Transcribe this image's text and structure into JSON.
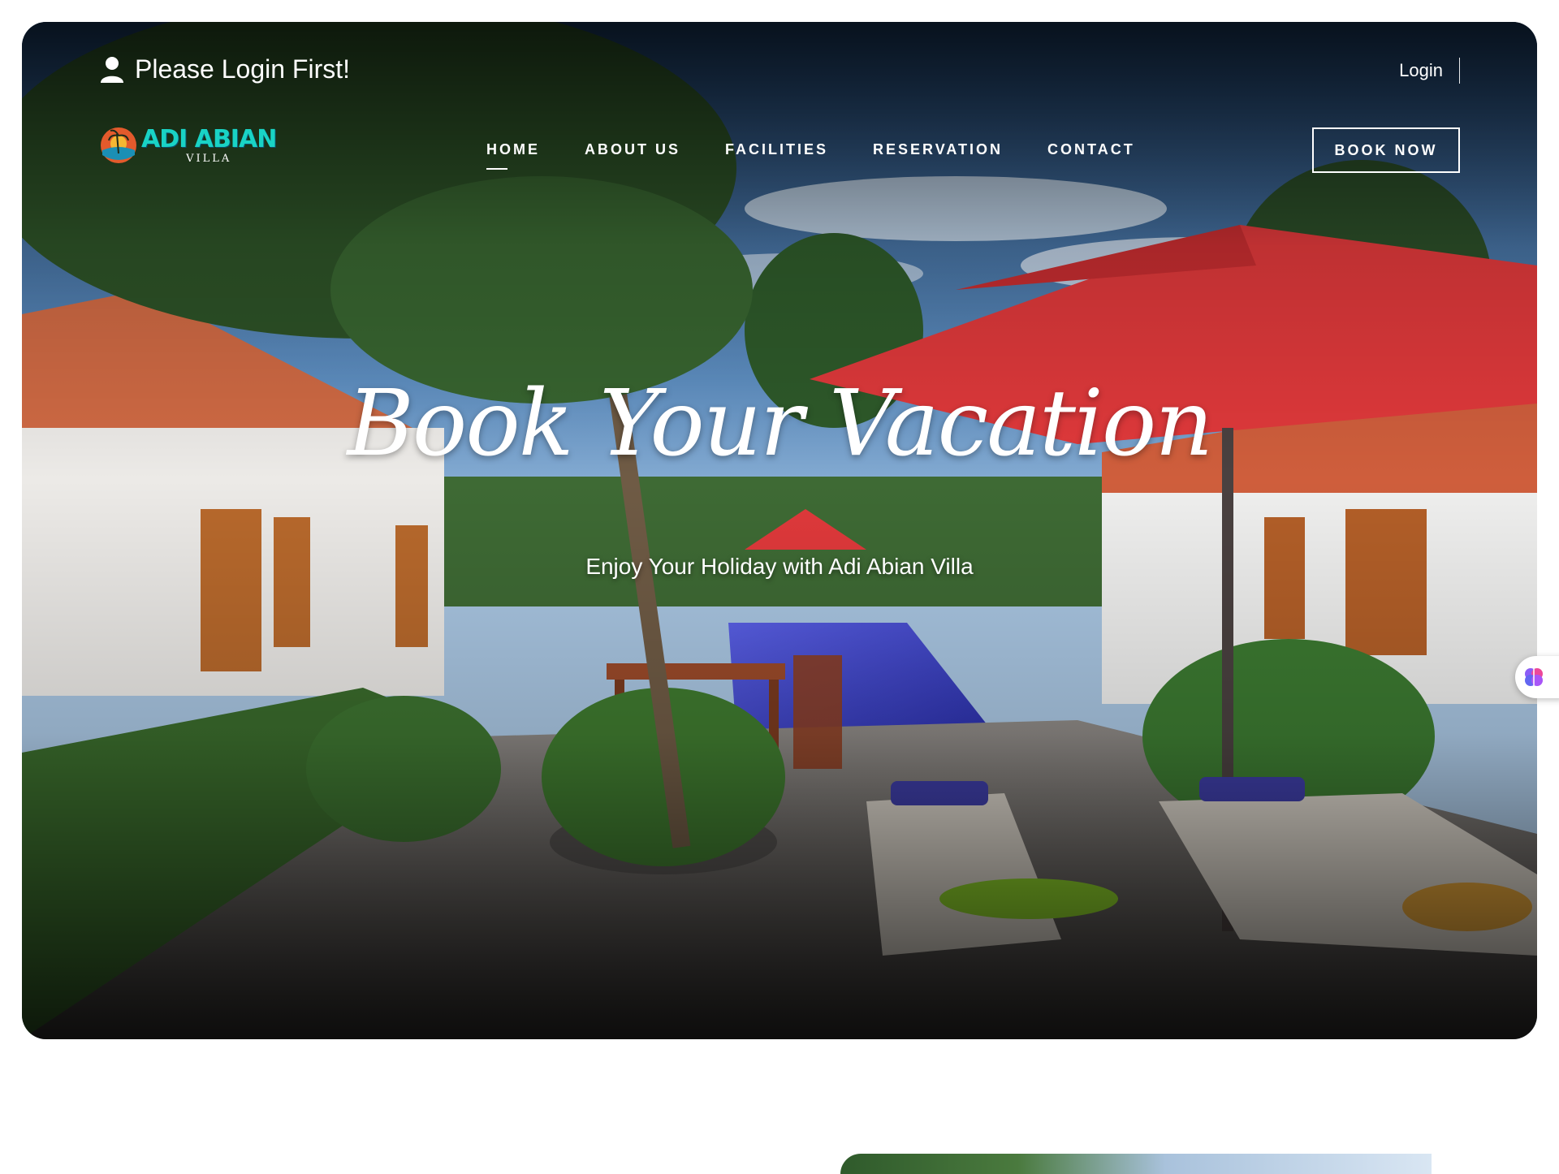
{
  "topbar": {
    "login_message": "Please Login First!",
    "login_link": "Login"
  },
  "logo": {
    "main": "ADI ABIAN",
    "sub": "VILLA"
  },
  "nav": {
    "items": [
      "HOME",
      "ABOUT US",
      "FACILITIES",
      "RESERVATION",
      "CONTACT"
    ],
    "active": "HOME"
  },
  "cta": {
    "book_now": "BOOK NOW"
  },
  "hero": {
    "headline": "Book Your Vacation",
    "subheadline": "Enjoy Your Holiday with Adi Abian Villa"
  },
  "icons": [
    "user-icon",
    "logo-mark-icon",
    "brain-icon"
  ],
  "colors": {
    "logo_accent": "#19d3c5",
    "umbrella": "#e0393b",
    "pool": "#3b3fd1"
  }
}
